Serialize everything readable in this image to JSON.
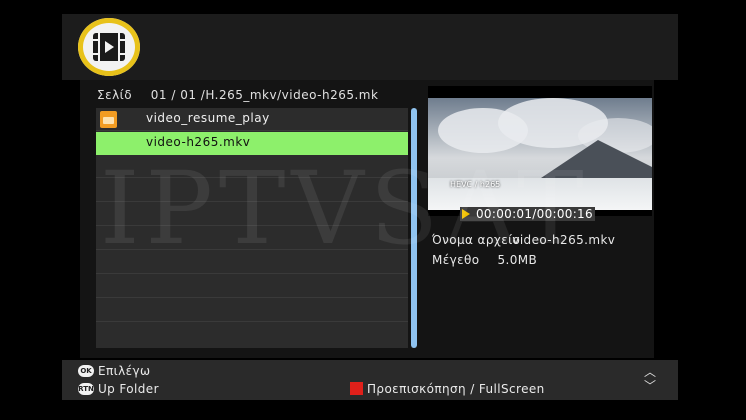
{
  "header": {
    "icon": "video-player-icon"
  },
  "browser": {
    "page_label": "Σελίδ",
    "page_current": "01",
    "page_total": "01",
    "path": "/H.265_mkv/video-h265.mk",
    "items": [
      {
        "label": "video_resume_play",
        "type": "folder",
        "icon": "folder-icon",
        "selected": false
      },
      {
        "label": "video-h265.mkv",
        "type": "file",
        "selected": true
      }
    ]
  },
  "preview": {
    "codec_label": "HEVC / h265",
    "time": "00:00:01/00:00:16",
    "filename_label": "Όνομα αρχείο",
    "filename_value": "video-h265.mkv",
    "size_label": "Μέγεθο",
    "size_value": "5.0MB"
  },
  "watermark": "IPTVSAT",
  "footer": {
    "ok_key": "OK",
    "ok_label": "Επιλέγω",
    "rtn_key": "RTN",
    "rtn_label": "Up Folder",
    "red_label": "Προεπισκόπηση / FullScreen",
    "up_arrow": "︿",
    "down_arrow": "﹀"
  },
  "colors": {
    "selection": "#8df06b",
    "accent_ring": "#e8c21a",
    "red_key": "#e0201a",
    "scrollbar": "#8fc3f0"
  }
}
